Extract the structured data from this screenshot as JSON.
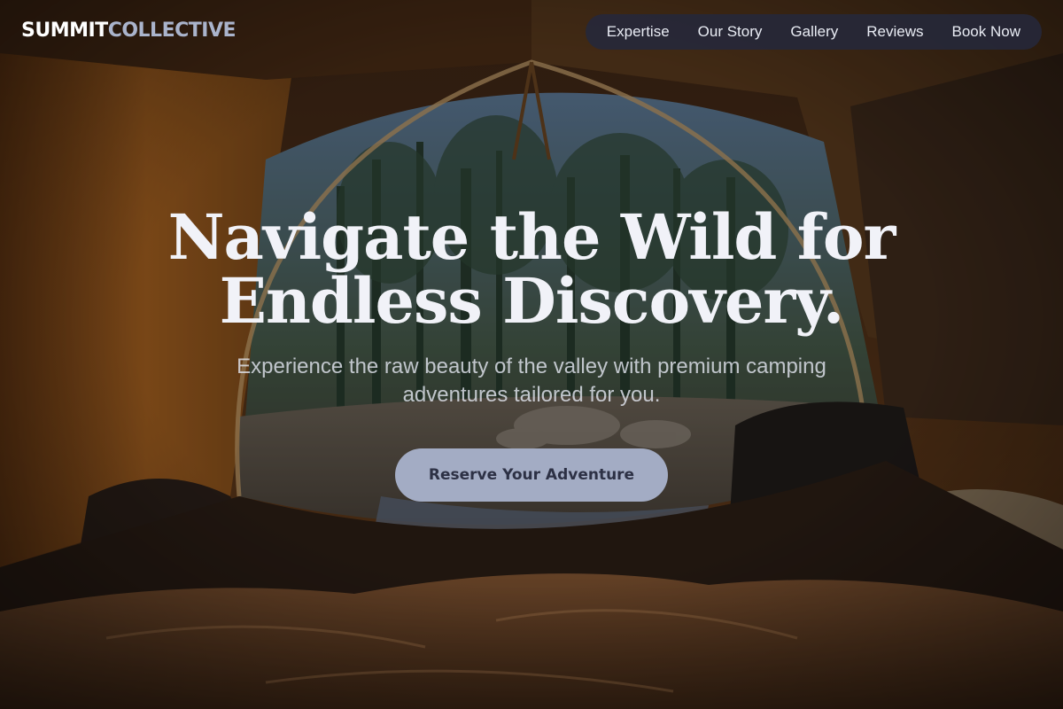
{
  "brand": {
    "name_part1": "SUMMIT",
    "name_part2": "COLLECTIVE"
  },
  "nav": {
    "items": [
      {
        "label": "Expertise"
      },
      {
        "label": "Our Story"
      },
      {
        "label": "Gallery"
      },
      {
        "label": "Reviews"
      },
      {
        "label": "Book Now"
      }
    ]
  },
  "hero": {
    "title": "Navigate the Wild for Endless Discovery.",
    "subtitle": "Experience the raw beauty of the valley with premium camping adventures tailored for you.",
    "cta_label": "Reserve Your Adventure",
    "background_image": "tent-interior-view-of-forest"
  },
  "colors": {
    "brand_primary": "#ffffff",
    "brand_secondary": "#aab4cc",
    "nav_background": "#26283a",
    "cta_background": "#a3acc4",
    "cta_text": "#2d3145"
  }
}
